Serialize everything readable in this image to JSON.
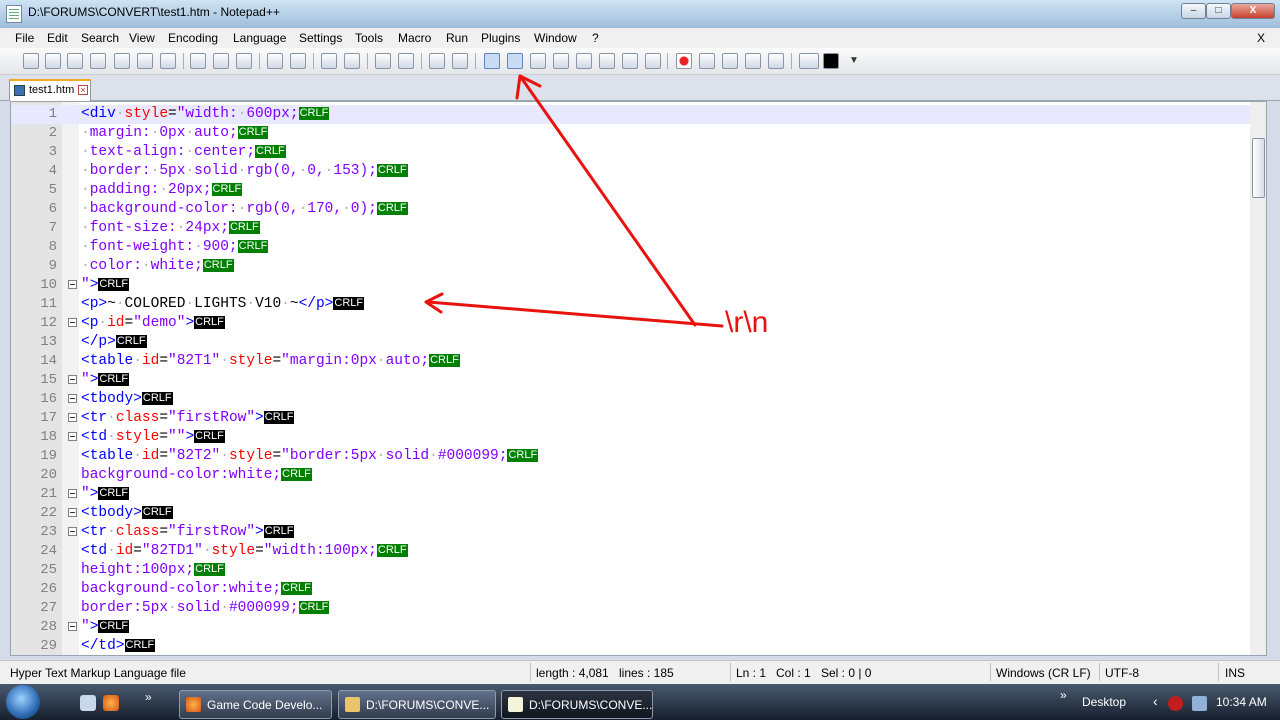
{
  "window": {
    "title": "D:\\FORUMS\\CONVERT\\test1.htm - Notepad++",
    "buttons": {
      "minimize": "–",
      "maximize": "□",
      "close": "X"
    }
  },
  "menu": {
    "items": [
      "File",
      "Edit",
      "Search",
      "View",
      "Encoding",
      "Language",
      "Settings",
      "Tools",
      "Macro",
      "Run",
      "Plugins",
      "Window",
      "?"
    ],
    "close": "X"
  },
  "tab": {
    "label": "test1.htm"
  },
  "lines": [
    {
      "n": "1",
      "parts": [
        {
          "c": "tag",
          "t": "<div"
        },
        {
          "c": "sp",
          "t": "·"
        },
        {
          "c": "attr",
          "t": "style"
        },
        {
          "c": "txt",
          "t": "="
        },
        {
          "c": "val",
          "t": "\"width:"
        },
        {
          "c": "sp",
          "t": "·"
        },
        {
          "c": "val",
          "t": "600px;"
        }
      ],
      "eol": "g"
    },
    {
      "n": "2",
      "parts": [
        {
          "c": "sp",
          "t": "·"
        },
        {
          "c": "val",
          "t": "margin:"
        },
        {
          "c": "sp",
          "t": "·"
        },
        {
          "c": "val",
          "t": "0px"
        },
        {
          "c": "sp",
          "t": "·"
        },
        {
          "c": "val",
          "t": "auto;"
        }
      ],
      "eol": "g"
    },
    {
      "n": "3",
      "parts": [
        {
          "c": "sp",
          "t": "·"
        },
        {
          "c": "val",
          "t": "text-align:"
        },
        {
          "c": "sp",
          "t": "·"
        },
        {
          "c": "val",
          "t": "center;"
        }
      ],
      "eol": "g"
    },
    {
      "n": "4",
      "parts": [
        {
          "c": "sp",
          "t": "·"
        },
        {
          "c": "val",
          "t": "border:"
        },
        {
          "c": "sp",
          "t": "·"
        },
        {
          "c": "val",
          "t": "5px"
        },
        {
          "c": "sp",
          "t": "·"
        },
        {
          "c": "val",
          "t": "solid"
        },
        {
          "c": "sp",
          "t": "·"
        },
        {
          "c": "val",
          "t": "rgb(0,"
        },
        {
          "c": "sp",
          "t": "·"
        },
        {
          "c": "val",
          "t": "0,"
        },
        {
          "c": "sp",
          "t": "·"
        },
        {
          "c": "val",
          "t": "153);"
        }
      ],
      "eol": "g"
    },
    {
      "n": "5",
      "parts": [
        {
          "c": "sp",
          "t": "·"
        },
        {
          "c": "val",
          "t": "padding:"
        },
        {
          "c": "sp",
          "t": "·"
        },
        {
          "c": "val",
          "t": "20px;"
        }
      ],
      "eol": "g"
    },
    {
      "n": "6",
      "parts": [
        {
          "c": "sp",
          "t": "·"
        },
        {
          "c": "val",
          "t": "background-color:"
        },
        {
          "c": "sp",
          "t": "·"
        },
        {
          "c": "val",
          "t": "rgb(0,"
        },
        {
          "c": "sp",
          "t": "·"
        },
        {
          "c": "val",
          "t": "170,"
        },
        {
          "c": "sp",
          "t": "·"
        },
        {
          "c": "val",
          "t": "0);"
        }
      ],
      "eol": "g"
    },
    {
      "n": "7",
      "parts": [
        {
          "c": "sp",
          "t": "·"
        },
        {
          "c": "val",
          "t": "font-size:"
        },
        {
          "c": "sp",
          "t": "·"
        },
        {
          "c": "val",
          "t": "24px;"
        }
      ],
      "eol": "g"
    },
    {
      "n": "8",
      "parts": [
        {
          "c": "sp",
          "t": "·"
        },
        {
          "c": "val",
          "t": "font-weight:"
        },
        {
          "c": "sp",
          "t": "·"
        },
        {
          "c": "val",
          "t": "900;"
        }
      ],
      "eol": "g"
    },
    {
      "n": "9",
      "parts": [
        {
          "c": "sp",
          "t": "·"
        },
        {
          "c": "val",
          "t": "color:"
        },
        {
          "c": "sp",
          "t": "·"
        },
        {
          "c": "val",
          "t": "white;"
        }
      ],
      "eol": "g"
    },
    {
      "n": "10",
      "fold": true,
      "parts": [
        {
          "c": "val",
          "t": "\""
        },
        {
          "c": "tag",
          "t": ">"
        }
      ],
      "eol": "k"
    },
    {
      "n": "11",
      "parts": [
        {
          "c": "tag",
          "t": "<p>"
        },
        {
          "c": "txt",
          "t": "~"
        },
        {
          "c": "sp",
          "t": "·"
        },
        {
          "c": "txt",
          "t": "COLORED"
        },
        {
          "c": "sp",
          "t": "·"
        },
        {
          "c": "txt",
          "t": "LIGHTS"
        },
        {
          "c": "sp",
          "t": "·"
        },
        {
          "c": "txt",
          "t": "V10"
        },
        {
          "c": "sp",
          "t": "·"
        },
        {
          "c": "txt",
          "t": "~"
        },
        {
          "c": "tag",
          "t": "</p>"
        }
      ],
      "eol": "k"
    },
    {
      "n": "12",
      "fold": true,
      "parts": [
        {
          "c": "tag",
          "t": "<p"
        },
        {
          "c": "sp",
          "t": "·"
        },
        {
          "c": "attr",
          "t": "id"
        },
        {
          "c": "txt",
          "t": "="
        },
        {
          "c": "val",
          "t": "\"demo\""
        },
        {
          "c": "tag",
          "t": ">"
        }
      ],
      "eol": "k"
    },
    {
      "n": "13",
      "parts": [
        {
          "c": "tag",
          "t": "</p>"
        }
      ],
      "eol": "k"
    },
    {
      "n": "14",
      "parts": [
        {
          "c": "tag",
          "t": "<table"
        },
        {
          "c": "sp",
          "t": "·"
        },
        {
          "c": "attr",
          "t": "id"
        },
        {
          "c": "txt",
          "t": "="
        },
        {
          "c": "val",
          "t": "\"82T1\""
        },
        {
          "c": "sp",
          "t": "·"
        },
        {
          "c": "attr",
          "t": "style"
        },
        {
          "c": "txt",
          "t": "="
        },
        {
          "c": "val",
          "t": "\"margin:0px"
        },
        {
          "c": "sp",
          "t": "·"
        },
        {
          "c": "val",
          "t": "auto;"
        }
      ],
      "eol": "g"
    },
    {
      "n": "15",
      "fold": true,
      "parts": [
        {
          "c": "val",
          "t": "\""
        },
        {
          "c": "tag",
          "t": ">"
        }
      ],
      "eol": "k"
    },
    {
      "n": "16",
      "fold": true,
      "parts": [
        {
          "c": "tag",
          "t": "<tbody>"
        }
      ],
      "eol": "k"
    },
    {
      "n": "17",
      "fold": true,
      "parts": [
        {
          "c": "tag",
          "t": "<tr"
        },
        {
          "c": "sp",
          "t": "·"
        },
        {
          "c": "attr",
          "t": "class"
        },
        {
          "c": "txt",
          "t": "="
        },
        {
          "c": "val",
          "t": "\"firstRow\""
        },
        {
          "c": "tag",
          "t": ">"
        }
      ],
      "eol": "k"
    },
    {
      "n": "18",
      "fold": true,
      "parts": [
        {
          "c": "tag",
          "t": "<td"
        },
        {
          "c": "sp",
          "t": "·"
        },
        {
          "c": "attr",
          "t": "style"
        },
        {
          "c": "txt",
          "t": "="
        },
        {
          "c": "val",
          "t": "\"\""
        },
        {
          "c": "tag",
          "t": ">"
        }
      ],
      "eol": "k"
    },
    {
      "n": "19",
      "parts": [
        {
          "c": "tag",
          "t": "<table"
        },
        {
          "c": "sp",
          "t": "·"
        },
        {
          "c": "attr",
          "t": "id"
        },
        {
          "c": "txt",
          "t": "="
        },
        {
          "c": "val",
          "t": "\"82T2\""
        },
        {
          "c": "sp",
          "t": "·"
        },
        {
          "c": "attr",
          "t": "style"
        },
        {
          "c": "txt",
          "t": "="
        },
        {
          "c": "val",
          "t": "\"border:5px"
        },
        {
          "c": "sp",
          "t": "·"
        },
        {
          "c": "val",
          "t": "solid"
        },
        {
          "c": "sp",
          "t": "·"
        },
        {
          "c": "val",
          "t": "#000099;"
        }
      ],
      "eol": "g"
    },
    {
      "n": "20",
      "parts": [
        {
          "c": "val",
          "t": "background-color:white;"
        }
      ],
      "eol": "g"
    },
    {
      "n": "21",
      "fold": true,
      "parts": [
        {
          "c": "val",
          "t": "\""
        },
        {
          "c": "tag",
          "t": ">"
        }
      ],
      "eol": "k"
    },
    {
      "n": "22",
      "fold": true,
      "parts": [
        {
          "c": "tag",
          "t": "<tbody>"
        }
      ],
      "eol": "k"
    },
    {
      "n": "23",
      "fold": true,
      "parts": [
        {
          "c": "tag",
          "t": "<tr"
        },
        {
          "c": "sp",
          "t": "·"
        },
        {
          "c": "attr",
          "t": "class"
        },
        {
          "c": "txt",
          "t": "="
        },
        {
          "c": "val",
          "t": "\"firstRow\""
        },
        {
          "c": "tag",
          "t": ">"
        }
      ],
      "eol": "k"
    },
    {
      "n": "24",
      "parts": [
        {
          "c": "tag",
          "t": "<td"
        },
        {
          "c": "sp",
          "t": "·"
        },
        {
          "c": "attr",
          "t": "id"
        },
        {
          "c": "txt",
          "t": "="
        },
        {
          "c": "val",
          "t": "\"82TD1\""
        },
        {
          "c": "sp",
          "t": "·"
        },
        {
          "c": "attr",
          "t": "style"
        },
        {
          "c": "txt",
          "t": "="
        },
        {
          "c": "val",
          "t": "\"width:100px;"
        }
      ],
      "eol": "g"
    },
    {
      "n": "25",
      "parts": [
        {
          "c": "val",
          "t": "height:100px;"
        }
      ],
      "eol": "g"
    },
    {
      "n": "26",
      "parts": [
        {
          "c": "val",
          "t": "background-color:white;"
        }
      ],
      "eol": "g"
    },
    {
      "n": "27",
      "parts": [
        {
          "c": "val",
          "t": "border:5px"
        },
        {
          "c": "sp",
          "t": "·"
        },
        {
          "c": "val",
          "t": "solid"
        },
        {
          "c": "sp",
          "t": "·"
        },
        {
          "c": "val",
          "t": "#000099;"
        }
      ],
      "eol": "g"
    },
    {
      "n": "28",
      "fold": true,
      "parts": [
        {
          "c": "val",
          "t": "\""
        },
        {
          "c": "tag",
          "t": ">"
        }
      ],
      "eol": "k"
    },
    {
      "n": "29",
      "parts": [
        {
          "c": "tag",
          "t": "</td>"
        }
      ],
      "eol": "k"
    }
  ],
  "eol_label": "CRLF",
  "annotation": {
    "text": "\\r\\n",
    "color": "#e8120f"
  },
  "status": {
    "file_type": "Hyper Text Markup Language file",
    "length": "length : 4,081",
    "lines": "lines : 185",
    "ln": "Ln : 1",
    "col": "Col : 1",
    "sel": "Sel : 0 | 0",
    "eol_mode": "Windows (CR LF)",
    "encoding": "UTF-8",
    "mode": "INS"
  },
  "taskbar": {
    "tasks": [
      {
        "label": "Game Code Develo..."
      },
      {
        "label": "D:\\FORUMS\\CONVE..."
      },
      {
        "label": "D:\\FORUMS\\CONVE..."
      }
    ],
    "desktop": "Desktop",
    "clock": "10:34 AM"
  }
}
